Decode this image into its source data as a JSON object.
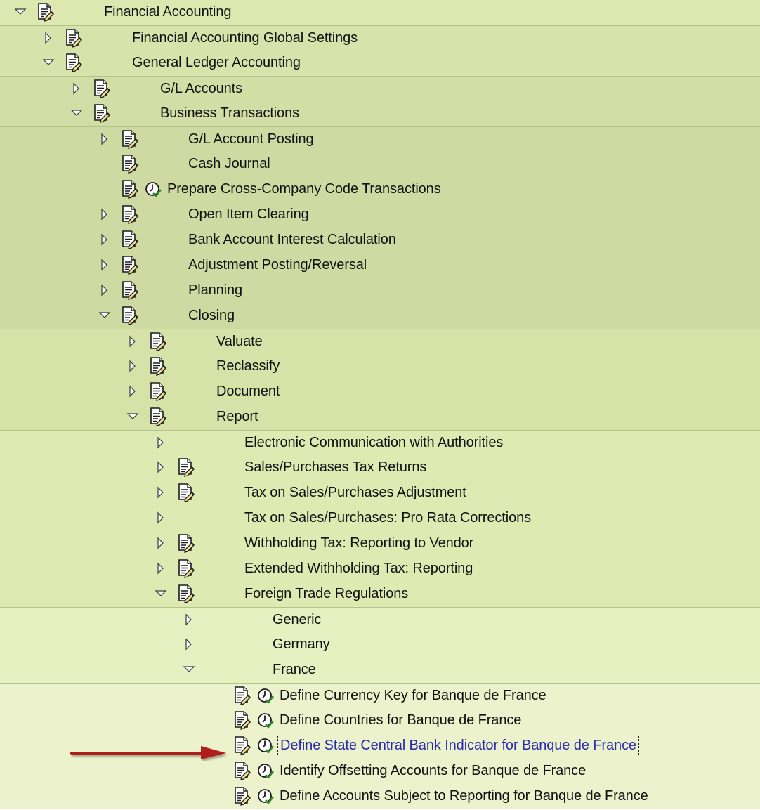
{
  "tree": {
    "nodes": [
      {
        "label": "Financial Accounting",
        "toggle": "expanded",
        "doc": true,
        "clock": false
      },
      {
        "label": "Financial Accounting Global Settings",
        "toggle": "collapsed",
        "doc": true,
        "clock": false
      },
      {
        "label": "General Ledger Accounting",
        "toggle": "expanded",
        "doc": true,
        "clock": false
      },
      {
        "label": "G/L Accounts",
        "toggle": "collapsed",
        "doc": true,
        "clock": false
      },
      {
        "label": "Business Transactions",
        "toggle": "expanded",
        "doc": true,
        "clock": false
      },
      {
        "label": "G/L Account Posting",
        "toggle": "collapsed",
        "doc": true,
        "clock": false
      },
      {
        "label": "Cash Journal",
        "toggle": "none",
        "doc": true,
        "clock": false
      },
      {
        "label": "Prepare Cross-Company Code Transactions",
        "toggle": "none",
        "doc": true,
        "clock": true
      },
      {
        "label": "Open Item Clearing",
        "toggle": "collapsed",
        "doc": true,
        "clock": false
      },
      {
        "label": "Bank Account Interest Calculation",
        "toggle": "collapsed",
        "doc": true,
        "clock": false
      },
      {
        "label": "Adjustment Posting/Reversal",
        "toggle": "collapsed",
        "doc": true,
        "clock": false
      },
      {
        "label": "Planning",
        "toggle": "collapsed",
        "doc": true,
        "clock": false
      },
      {
        "label": "Closing",
        "toggle": "expanded",
        "doc": true,
        "clock": false
      },
      {
        "label": "Valuate",
        "toggle": "collapsed",
        "doc": true,
        "clock": false
      },
      {
        "label": "Reclassify",
        "toggle": "collapsed",
        "doc": true,
        "clock": false
      },
      {
        "label": "Document",
        "toggle": "collapsed",
        "doc": true,
        "clock": false
      },
      {
        "label": "Report",
        "toggle": "expanded",
        "doc": true,
        "clock": false
      },
      {
        "label": "Electronic Communication with Authorities",
        "toggle": "collapsed",
        "doc": false,
        "clock": false
      },
      {
        "label": "Sales/Purchases Tax Returns",
        "toggle": "collapsed",
        "doc": true,
        "clock": false
      },
      {
        "label": "Tax on Sales/Purchases Adjustment",
        "toggle": "collapsed",
        "doc": true,
        "clock": false
      },
      {
        "label": "Tax on Sales/Purchases: Pro Rata Corrections",
        "toggle": "collapsed",
        "doc": false,
        "clock": false
      },
      {
        "label": "Withholding Tax: Reporting to Vendor",
        "toggle": "collapsed",
        "doc": true,
        "clock": false
      },
      {
        "label": "Extended Withholding Tax: Reporting",
        "toggle": "collapsed",
        "doc": true,
        "clock": false
      },
      {
        "label": "Foreign Trade Regulations",
        "toggle": "expanded",
        "doc": true,
        "clock": false
      },
      {
        "label": "Generic",
        "toggle": "collapsed",
        "doc": false,
        "clock": false
      },
      {
        "label": "Germany",
        "toggle": "collapsed",
        "doc": false,
        "clock": false
      },
      {
        "label": "France",
        "toggle": "expanded",
        "doc": false,
        "clock": false
      },
      {
        "label": "Define Currency Key for Banque de France",
        "toggle": "none",
        "doc": true,
        "clock": true
      },
      {
        "label": "Define Countries for Banque de France",
        "toggle": "none",
        "doc": true,
        "clock": true
      },
      {
        "label": "Define State Central Bank Indicator for Banque de France",
        "toggle": "none",
        "doc": true,
        "clock": true,
        "selected": true
      },
      {
        "label": "Identify Offsetting Accounts for Banque de France",
        "toggle": "none",
        "doc": true,
        "clock": true
      },
      {
        "label": "Define Accounts Subject to Reporting for Banque de France",
        "toggle": "none",
        "doc": true,
        "clock": true
      }
    ]
  },
  "colors": {
    "level_0": "#dde8b0",
    "level_1": "#d8e3ab",
    "level_2": "#d3dea6",
    "level_3": "#cfdaa2",
    "level_4": "#d6e2a8",
    "level_5": "#dfeab2",
    "level_6": "#e7f0c0",
    "level_7": "#ecf3cc",
    "selected_text": "#2a2ab0",
    "arrow": "#b11c1c"
  },
  "icons": {
    "expanded": "triangle-down-icon",
    "collapsed": "triangle-right-icon",
    "doc": "document-pen-icon",
    "clock": "clock-check-icon",
    "pointer": "red-arrow-icon"
  }
}
